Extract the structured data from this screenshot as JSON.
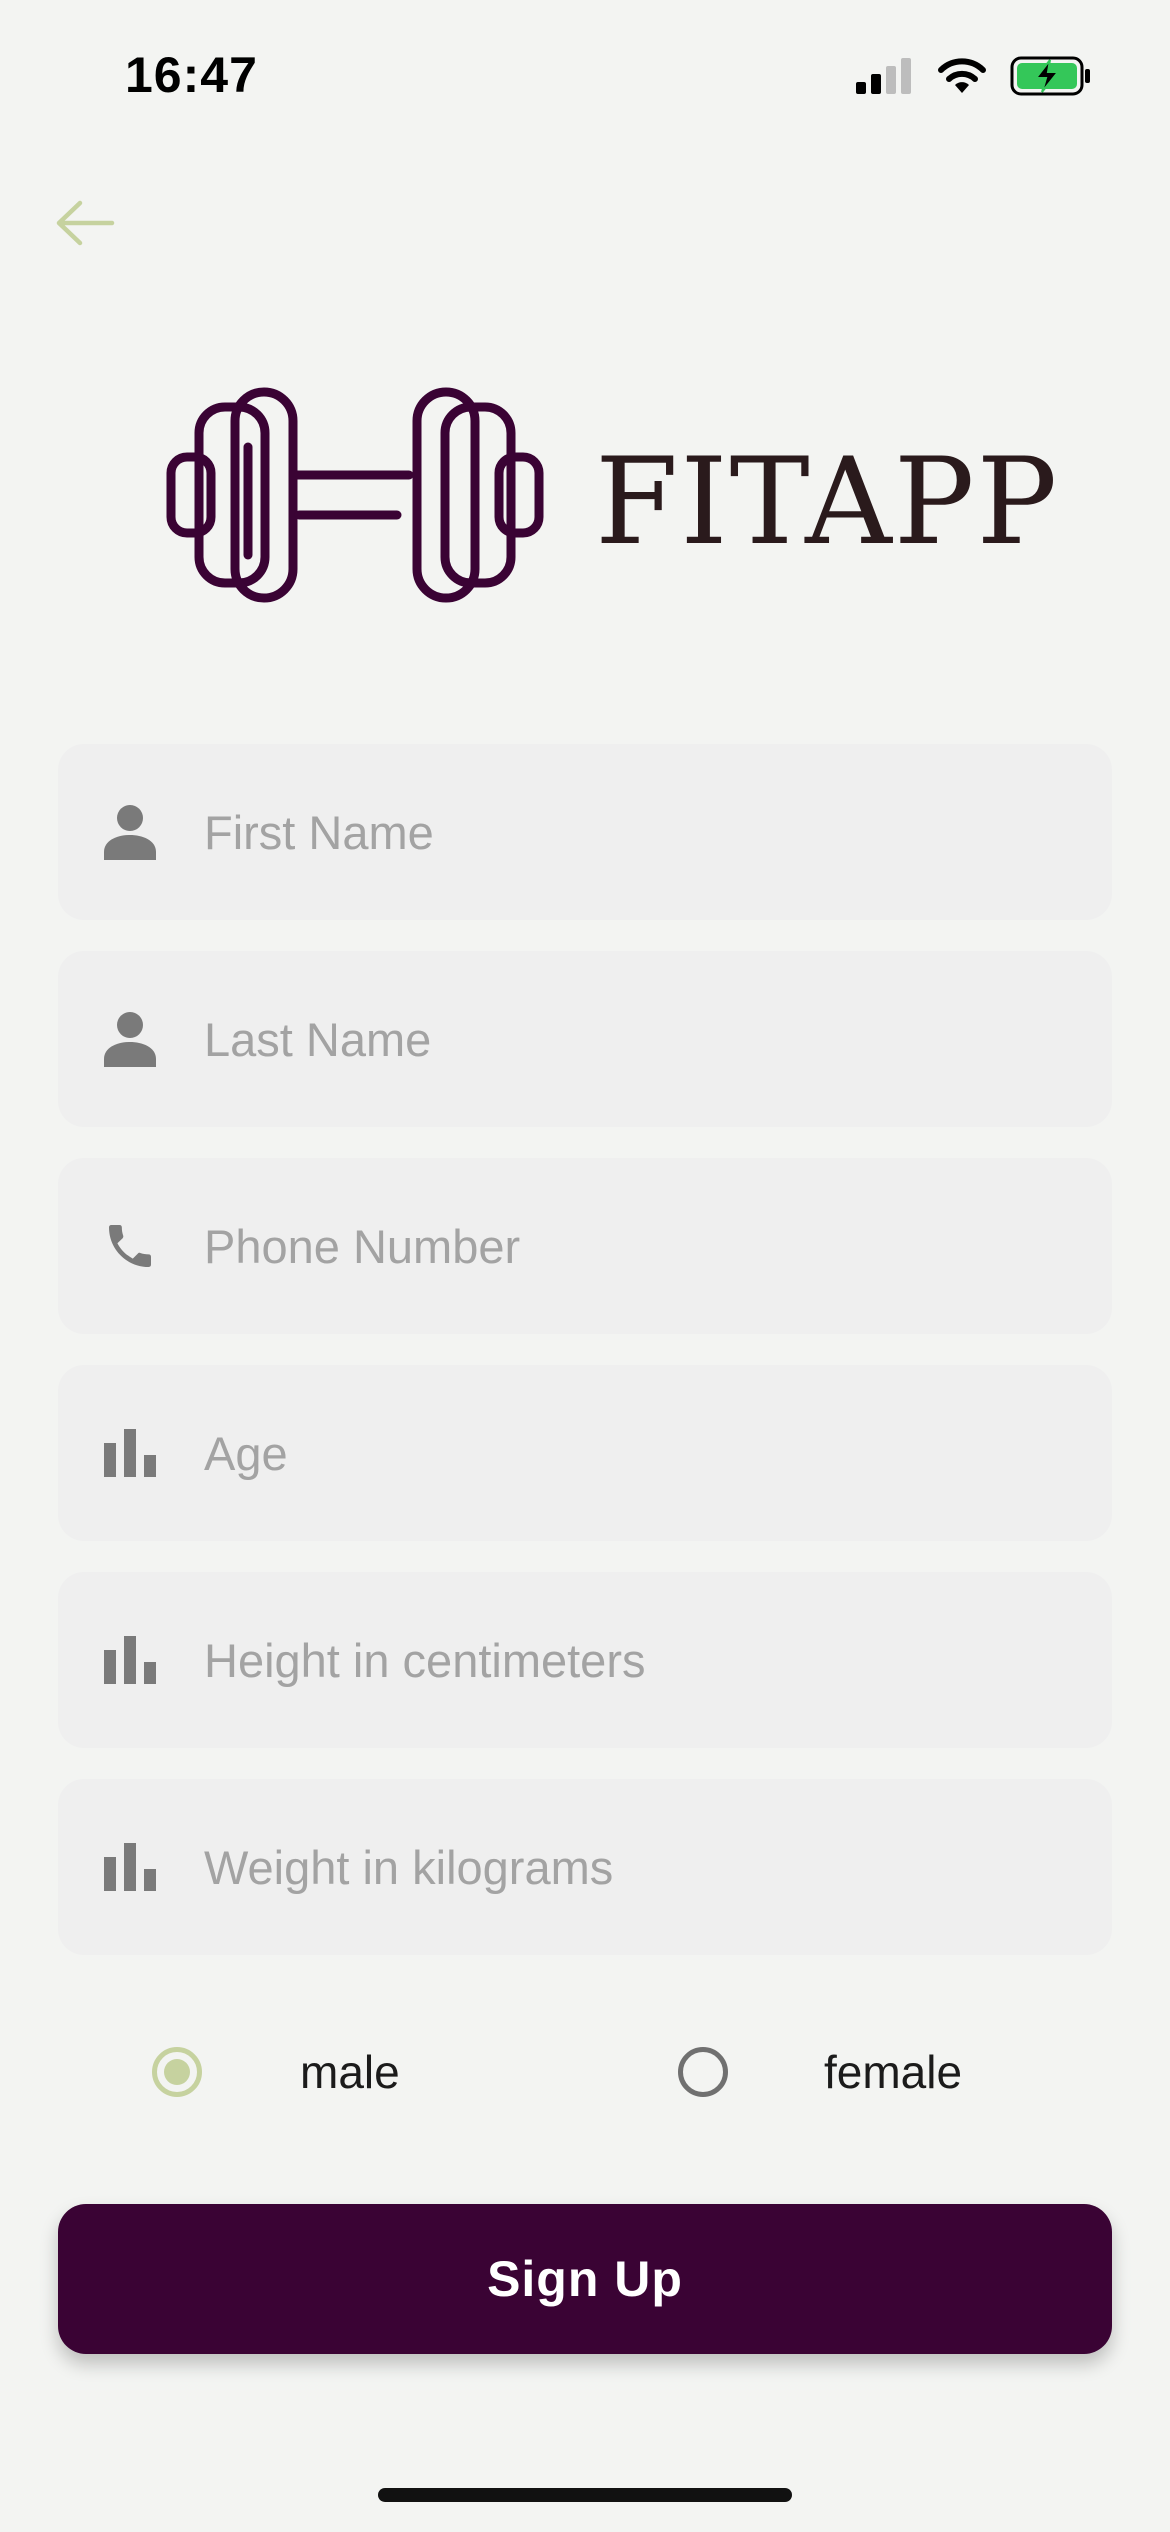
{
  "status_bar": {
    "time": "16:47",
    "icons": [
      "cellular-signal-icon",
      "wifi-icon",
      "battery-charging-icon"
    ]
  },
  "header": {
    "back_icon": "arrow-left-icon"
  },
  "logo": {
    "icon": "dumbbell-icon",
    "text": "FITAPP"
  },
  "form": {
    "fields": [
      {
        "icon": "person-icon",
        "placeholder": "First Name",
        "value": ""
      },
      {
        "icon": "person-icon",
        "placeholder": "Last Name",
        "value": ""
      },
      {
        "icon": "phone-icon",
        "placeholder": "Phone Number",
        "value": ""
      },
      {
        "icon": "bar-chart-icon",
        "placeholder": "Age",
        "value": ""
      },
      {
        "icon": "bar-chart-icon",
        "placeholder": "Height in centimeters",
        "value": ""
      },
      {
        "icon": "bar-chart-icon",
        "placeholder": "Weight in kilograms",
        "value": ""
      }
    ],
    "gender": {
      "options": [
        {
          "label": "male",
          "selected": true
        },
        {
          "label": "female",
          "selected": false
        }
      ]
    },
    "submit_label": "Sign Up"
  },
  "colors": {
    "background": "#f3f4f2",
    "field_background": "#efefef",
    "placeholder": "#a3a3a3",
    "accent": "#c6d29f",
    "brand": "#3a0334",
    "logo_icon": "#3a0334",
    "logo_text": "#2a1a1c"
  }
}
